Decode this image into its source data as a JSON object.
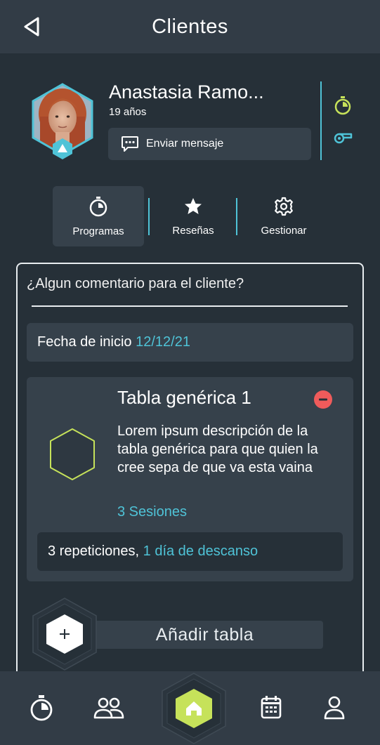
{
  "header": {
    "title": "Clientes"
  },
  "client": {
    "name": "Anastasia Ramo...",
    "age": "19 años",
    "message_button": "Enviar mensaje"
  },
  "tabs": [
    {
      "label": "Programas",
      "icon": "stopwatch-icon",
      "active": true
    },
    {
      "label": "Reseñas",
      "icon": "star-icon",
      "active": false
    },
    {
      "label": "Gestionar",
      "icon": "gear-icon",
      "active": false
    }
  ],
  "comment": {
    "placeholder": "¿Algun comentario para el cliente?"
  },
  "start_date": {
    "label": "Fecha de inicio",
    "value": "12/12/21"
  },
  "table": {
    "title": "Tabla genérica 1",
    "description": "Lorem ipsum descripción de la tabla genérica para que quien la cree sepa de que va esta vaina",
    "sessions": "3 Sesiones",
    "repetitions": "3 repeticiones,",
    "rest": "1 día de descanso"
  },
  "add_table": {
    "label": "Añadir tabla"
  },
  "bottom_nav": [
    "stopwatch-icon",
    "users-icon",
    "home-icon",
    "calendar-icon",
    "profile-icon"
  ],
  "colors": {
    "background": "#263038",
    "panel": "#36414b",
    "header": "#323c46",
    "accent": "#4fc3d7",
    "lime": "#c6e25a",
    "danger": "#ef5b5b"
  }
}
